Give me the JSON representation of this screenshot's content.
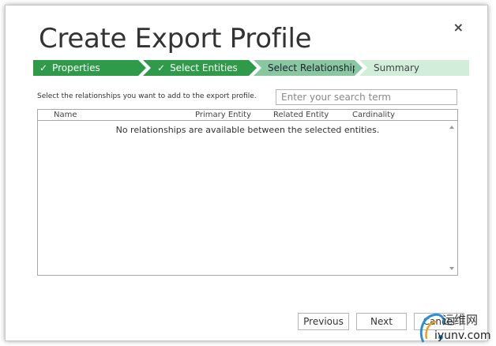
{
  "dialog": {
    "title": "Create Export Profile",
    "close_glyph": "×"
  },
  "steps": [
    {
      "label": "Properties",
      "state": "done",
      "check": "✓"
    },
    {
      "label": "Select Entities",
      "state": "done",
      "check": "✓"
    },
    {
      "label": "Select Relationships",
      "state": "current"
    },
    {
      "label": "Summary",
      "state": "future"
    }
  ],
  "instruction": "Select the relationships you want to add to the export profile.",
  "search": {
    "placeholder": "Enter your search term",
    "value": ""
  },
  "grid": {
    "columns": [
      "Name",
      "Primary Entity",
      "Related Entity",
      "Cardinality"
    ],
    "empty_message": "No relationships are available between the selected entities."
  },
  "buttons": {
    "previous": "Previous",
    "next": "Next",
    "cancel": "Cancel"
  },
  "watermark": {
    "cn": "运维网",
    "url": "iyunv.com"
  },
  "colors": {
    "step_done": "#2e9a4a",
    "step_current": "#88c7a0",
    "step_future": "#d2eedb"
  }
}
